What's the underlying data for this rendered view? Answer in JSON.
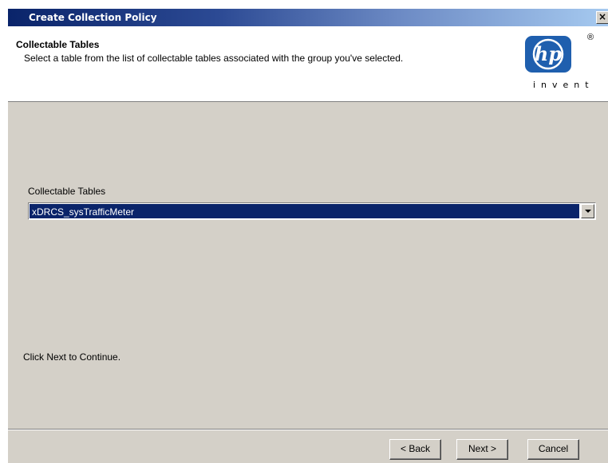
{
  "window": {
    "title": "Create Collection Policy",
    "close_glyph": "×"
  },
  "header": {
    "heading": "Collectable Tables",
    "subheading": "Select a table from the list of collectable tables associated with the group you've selected.",
    "logo": {
      "mark": "hp",
      "registered": "®",
      "tagline": "invent",
      "color": "#1f5fae"
    }
  },
  "content": {
    "field_label": "Collectable Tables",
    "combo_value": "xDRCS_sysTrafficMeter",
    "hint": "Click Next to Continue."
  },
  "buttons": {
    "back": "< Back",
    "next": "Next >",
    "cancel": "Cancel"
  },
  "colors": {
    "title_start": "#0a246a",
    "title_end": "#a6caf0",
    "face": "#d4d0c8",
    "selection": "#0a246a"
  },
  "icons": {
    "close": "close-icon",
    "dropdown": "chevron-down-icon"
  }
}
